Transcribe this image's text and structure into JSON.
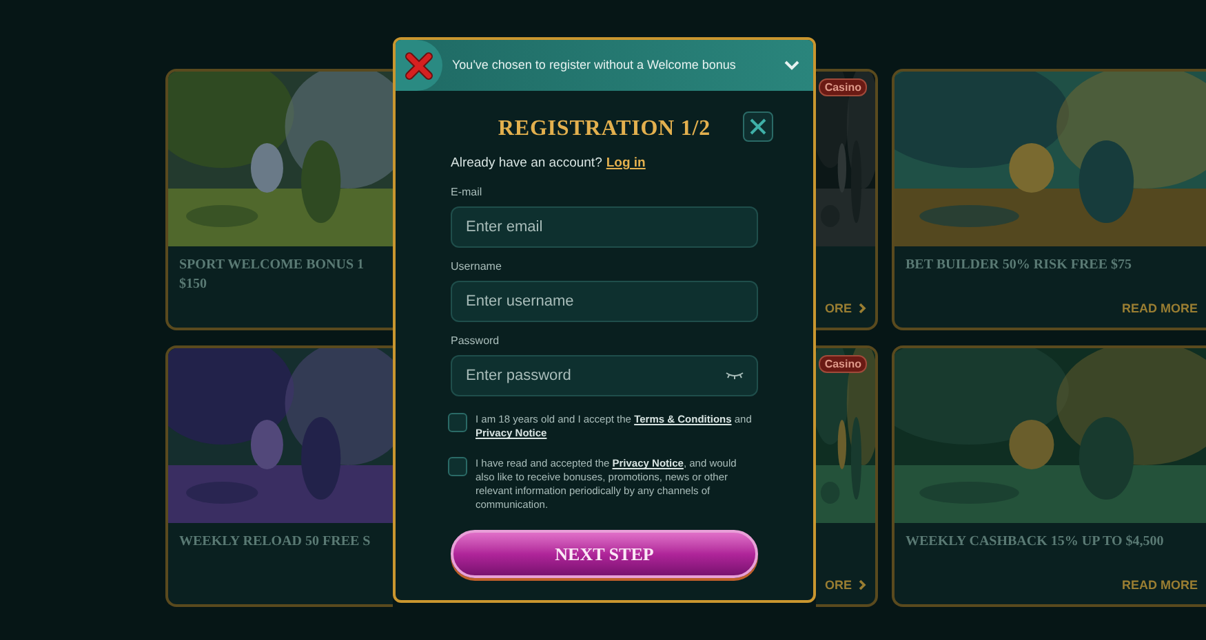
{
  "promotions": [
    {
      "title_lines": [
        "SPORT WELCOME BONUS 1",
        "$150"
      ]
    },
    {
      "badge": "Casino",
      "read_more": "ORE"
    },
    {
      "title_lines": [
        "BET BUILDER 50% RISK FREE $75"
      ],
      "read_more": "READ MORE"
    },
    {
      "title_lines": [
        "WEEKLY RELOAD 50 FREE S"
      ]
    },
    {
      "badge": "Casino",
      "read_more": "ORE"
    },
    {
      "title_lines": [
        "WEEKLY CASHBACK 15% UP TO $4,500"
      ],
      "read_more": "READ MORE"
    }
  ],
  "modal": {
    "banner": {
      "text": "You've chosen to register without a Welcome bonus",
      "expanded": false
    },
    "title": "REGISTRATION 1/2",
    "account_prompt": "Already have an account?",
    "login_link": "Log in",
    "fields": [
      {
        "label": "E-mail",
        "placeholder": "Enter email",
        "kind": "text"
      },
      {
        "label": "Username",
        "placeholder": "Enter username",
        "kind": "text"
      },
      {
        "label": "Password",
        "placeholder": "Enter password",
        "kind": "password"
      }
    ],
    "consents": [
      {
        "text": "I am 18 years old and I accept the **Terms & Conditions** and **Privacy Notice**",
        "checked": false
      },
      {
        "text": "I have read and accepted the **Privacy Notice**, and would also like to receive bonuses, promotions, news or other relevant information periodically by any channels of communication.",
        "checked": false
      }
    ],
    "submit": "NEXT STEP"
  }
}
